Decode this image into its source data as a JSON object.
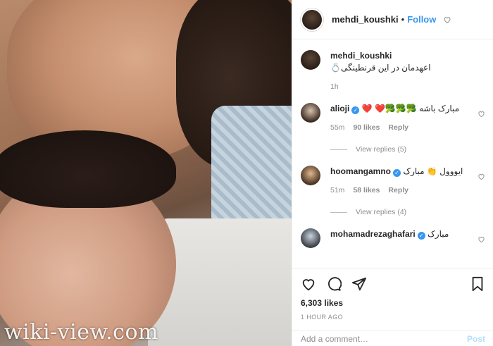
{
  "photo": {
    "watermark": "wiki-view.com"
  },
  "header": {
    "username": "mehdi_koushki",
    "separator": "•",
    "follow_label": "Follow"
  },
  "caption": {
    "username": "mehdi_koushki",
    "text": "اعهدمان در این قرنطینگی💍",
    "time": "1h"
  },
  "comments": [
    {
      "username": "alioji",
      "verified": true,
      "text": "مبارک باشه 🥦🥦🥦❤️ ❤️",
      "time": "55m",
      "likes": "90 likes",
      "reply": "Reply",
      "view_replies": "View replies (5)"
    },
    {
      "username": "hoomangamno",
      "verified": true,
      "text": "ایووول 👏 مبارک",
      "time": "51m",
      "likes": "58 likes",
      "reply": "Reply",
      "view_replies": "View replies (4)"
    },
    {
      "username": "mohamadrezaghafari",
      "verified": true,
      "text": "مبارک"
    }
  ],
  "actions": {
    "likes": "6,303 likes",
    "time_ago": "1 HOUR AGO"
  },
  "add_comment": {
    "placeholder": "Add a comment…",
    "post_label": "Post"
  },
  "icons": [
    "heart-icon",
    "comment-icon",
    "share-icon",
    "bookmark-icon",
    "verified-badge-icon"
  ],
  "colors": {
    "follow": "#3897f0",
    "verified": "#3897f0",
    "post_disabled": "#b2dffc",
    "meta": "#8e8e8e"
  }
}
